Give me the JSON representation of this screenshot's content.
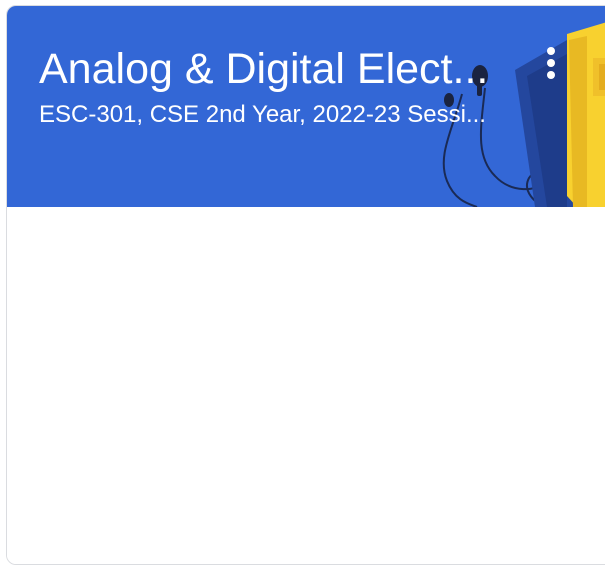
{
  "card": {
    "title": "Analog & Digital Elect...",
    "subtitle": "ESC-301, CSE 2nd Year, 2022-23 Sessi...",
    "more_icon": "more-vert-icon",
    "banner_illustration": "notebook-earbuds-illustration"
  },
  "colors": {
    "banner": "#3367d6",
    "notebook_side": "#24479e",
    "notebook_face": "#f8d12f",
    "card_border": "#dadce0"
  }
}
